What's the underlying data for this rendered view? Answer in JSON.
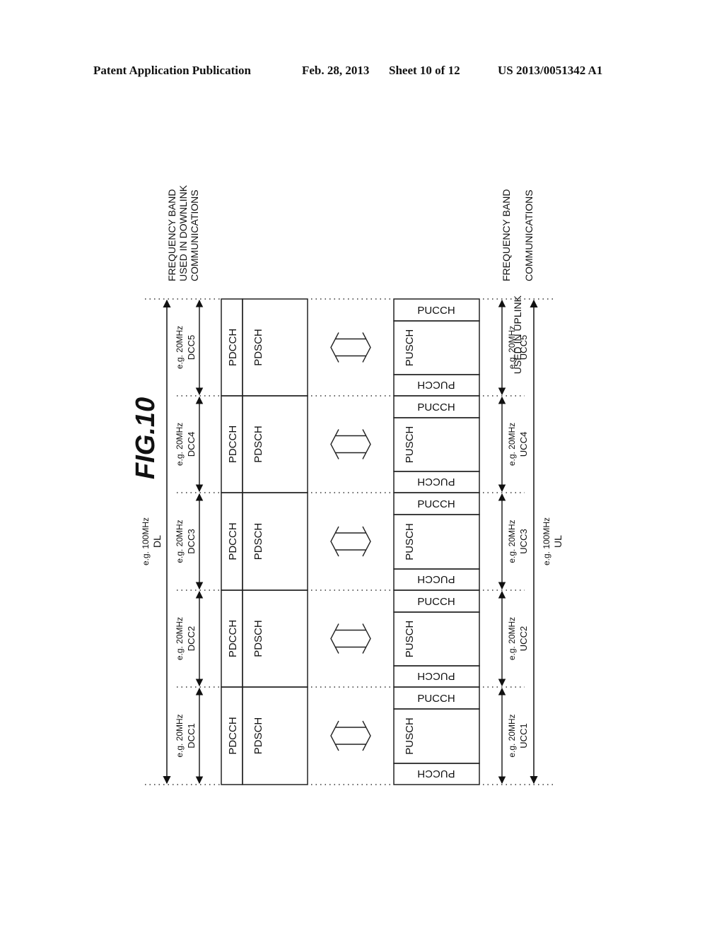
{
  "header": {
    "publication": "Patent Application Publication",
    "date": "Feb. 28, 2013",
    "sheet": "Sheet 10 of 12",
    "number": "US 2013/0051342 A1"
  },
  "figure": {
    "title": "FIG.10",
    "downlink_band_label": [
      "FREQUENCY BAND",
      "USED IN DOWNLINK",
      "COMMUNICATIONS"
    ],
    "uplink_band_label": [
      "FREQUENCY BAND",
      "USED IN UPLINK",
      "COMMUNICATIONS"
    ],
    "dl_total": {
      "bandwidth": "e.g. 100MHz",
      "name": "DL"
    },
    "ul_total": {
      "bandwidth": "e.g. 100MHz",
      "name": "UL"
    },
    "downlink_carriers": [
      {
        "name": "DCC5",
        "bandwidth": "e.g. 20MHz",
        "control": "PDCCH",
        "shared": "PDSCH"
      },
      {
        "name": "DCC4",
        "bandwidth": "e.g. 20MHz",
        "control": "PDCCH",
        "shared": "PDSCH"
      },
      {
        "name": "DCC3",
        "bandwidth": "e.g. 20MHz",
        "control": "PDCCH",
        "shared": "PDSCH"
      },
      {
        "name": "DCC2",
        "bandwidth": "e.g. 20MHz",
        "control": "PDCCH",
        "shared": "PDSCH"
      },
      {
        "name": "DCC1",
        "bandwidth": "e.g. 20MHz",
        "control": "PDCCH",
        "shared": "PDSCH"
      }
    ],
    "uplink_carriers": [
      {
        "name": "UCC5",
        "bandwidth": "e.g. 20MHz",
        "control_top": "PUCCH",
        "shared": "PUSCH",
        "control_bottom": "PUCCH"
      },
      {
        "name": "UCC4",
        "bandwidth": "e.g. 20MHz",
        "control_top": "PUCCH",
        "shared": "PUSCH",
        "control_bottom": "PUCCH"
      },
      {
        "name": "UCC3",
        "bandwidth": "e.g. 20MHz",
        "control_top": "PUCCH",
        "shared": "PUSCH",
        "control_bottom": "PUCCH"
      },
      {
        "name": "UCC2",
        "bandwidth": "e.g. 20MHz",
        "control_top": "PUCCH",
        "shared": "PUSCH",
        "control_bottom": "PUCCH"
      },
      {
        "name": "UCC1",
        "bandwidth": "e.g. 20MHz",
        "control_top": "PUCCH",
        "shared": "PUSCH",
        "control_bottom": "PUCCH"
      }
    ],
    "pairing_icon": "double-arrow-icon"
  }
}
